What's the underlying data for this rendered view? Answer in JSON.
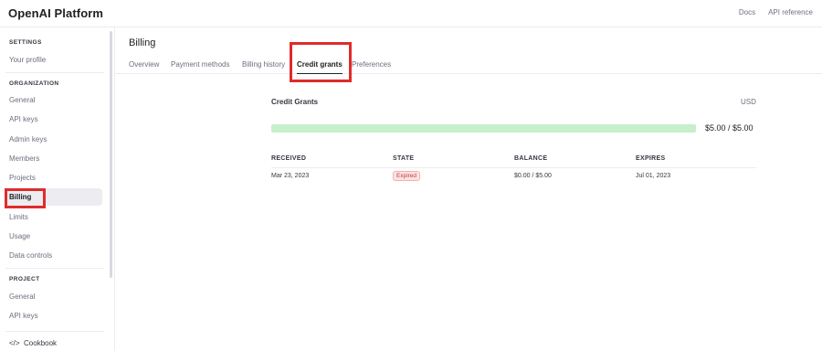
{
  "header": {
    "logo": "OpenAI  Platform",
    "links": [
      "Docs",
      "API reference"
    ]
  },
  "sidebar": {
    "sections": [
      {
        "title": "SETTINGS",
        "items": [
          "Your profile"
        ]
      },
      {
        "title": "ORGANIZATION",
        "items": [
          "General",
          "API keys",
          "Admin keys",
          "Members",
          "Projects",
          "Billing",
          "Limits",
          "Usage",
          "Data controls"
        ]
      },
      {
        "title": "PROJECT",
        "items": [
          "General",
          "API keys"
        ]
      }
    ],
    "active_item": "Billing",
    "footer": "Cookbook",
    "footer_icon": "code-icon"
  },
  "main": {
    "title": "Billing",
    "tabs": [
      "Overview",
      "Payment methods",
      "Billing history",
      "Credit grants",
      "Preferences"
    ],
    "active_tab": "Credit grants",
    "credit_grants": {
      "title": "Credit Grants",
      "currency": "USD",
      "progress_fraction": 1.0,
      "amount": "$5.00 / $5.00",
      "columns": [
        "RECEIVED",
        "STATE",
        "BALANCE",
        "EXPIRES"
      ],
      "rows": [
        {
          "received": "Mar 23, 2023",
          "state": "Expired",
          "balance": "$0.00 / $5.00",
          "expires": "Jul 01, 2023"
        }
      ]
    }
  },
  "colors": {
    "highlight": "#e02b2b",
    "progress": "#c6efcc",
    "badge_bg": "#fde2e2",
    "badge_text": "#c23d40"
  }
}
